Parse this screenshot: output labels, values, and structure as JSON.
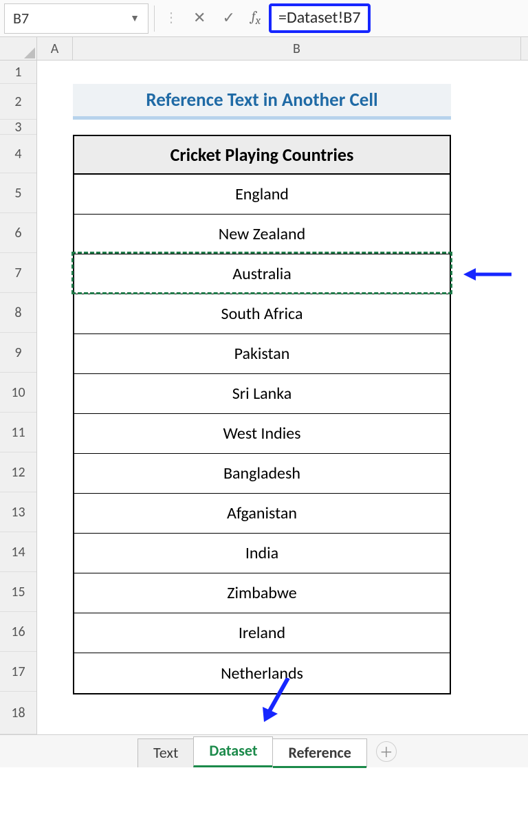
{
  "formula_bar": {
    "cell_ref": "B7",
    "formula": "=Dataset!B7"
  },
  "columns": {
    "A": "A",
    "B": "B"
  },
  "row_labels": [
    "1",
    "2",
    "3",
    "4",
    "5",
    "6",
    "7",
    "8",
    "9",
    "10",
    "11",
    "12",
    "13",
    "14",
    "15",
    "16",
    "17",
    "18"
  ],
  "title": "Reference Text in Another Cell",
  "table": {
    "header": "Cricket Playing Countries",
    "rows": [
      "England",
      "New Zealand",
      "Australia",
      "South Africa",
      "Pakistan",
      "Sri Lanka",
      "West Indies",
      "Bangladesh",
      "Afganistan",
      "India",
      "Zimbabwe",
      "Ireland",
      "Netherlands"
    ],
    "highlighted_index": 2
  },
  "tabs": {
    "items": [
      "Text",
      "Dataset",
      "Reference"
    ],
    "active": "Dataset"
  },
  "annotations": {
    "arrow_color": "#1626ff"
  }
}
